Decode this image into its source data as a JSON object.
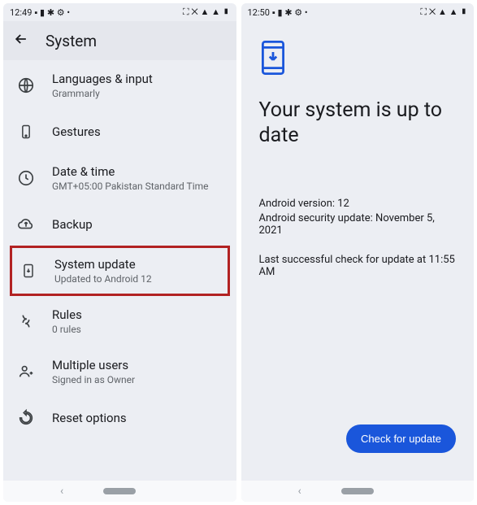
{
  "left": {
    "status_time": "12:49",
    "header_title": "System",
    "items": [
      {
        "title": "Languages & input",
        "sub": "Grammarly"
      },
      {
        "title": "Gestures",
        "sub": ""
      },
      {
        "title": "Date & time",
        "sub": "GMT+05:00 Pakistan Standard Time"
      },
      {
        "title": "Backup",
        "sub": ""
      },
      {
        "title": "System update",
        "sub": "Updated to Android 12"
      },
      {
        "title": "Rules",
        "sub": "0 rules"
      },
      {
        "title": "Multiple users",
        "sub": "Signed in as Owner"
      },
      {
        "title": "Reset options",
        "sub": ""
      }
    ]
  },
  "right": {
    "status_time": "12:50",
    "headline": "Your system is up to date",
    "version_line": "Android version: 12",
    "security_line": "Android security update: November 5, 2021",
    "last_check_line": "Last successful check for update at 11:55 AM",
    "button_label": "Check for update"
  }
}
